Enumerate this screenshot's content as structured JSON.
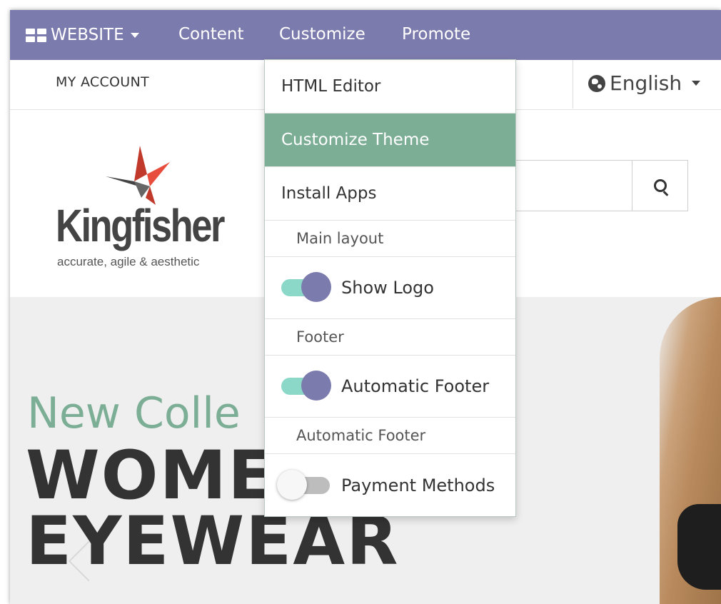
{
  "topbar": {
    "website_label": "WEBSITE",
    "nav": [
      "Content",
      "Customize",
      "Promote"
    ],
    "background": "#7c7bad"
  },
  "subbar": {
    "my_account": "MY ACCOUNT",
    "language": "English"
  },
  "logo": {
    "name": "Kingfisher",
    "tagline": "accurate, agile & aesthetic"
  },
  "hero": {
    "subtitle": "New Colle",
    "title_line1": "WOME",
    "title_line2": "EYEWEAR"
  },
  "dropdown": {
    "items": [
      "HTML Editor",
      "Customize Theme",
      "Install Apps"
    ],
    "active_item": "Customize Theme",
    "sections": [
      {
        "header": "Main layout",
        "toggle_label": "Show Logo",
        "toggle_on": true
      },
      {
        "header": "Footer",
        "toggle_label": "Automatic Footer",
        "toggle_on": true
      },
      {
        "header": "Automatic Footer",
        "toggle_label": "Payment Methods",
        "toggle_on": false
      }
    ]
  },
  "colors": {
    "accent_green": "#7cae96",
    "toggle_track_on": "#8bd8c8",
    "toggle_knob_on": "#7c7bad"
  }
}
